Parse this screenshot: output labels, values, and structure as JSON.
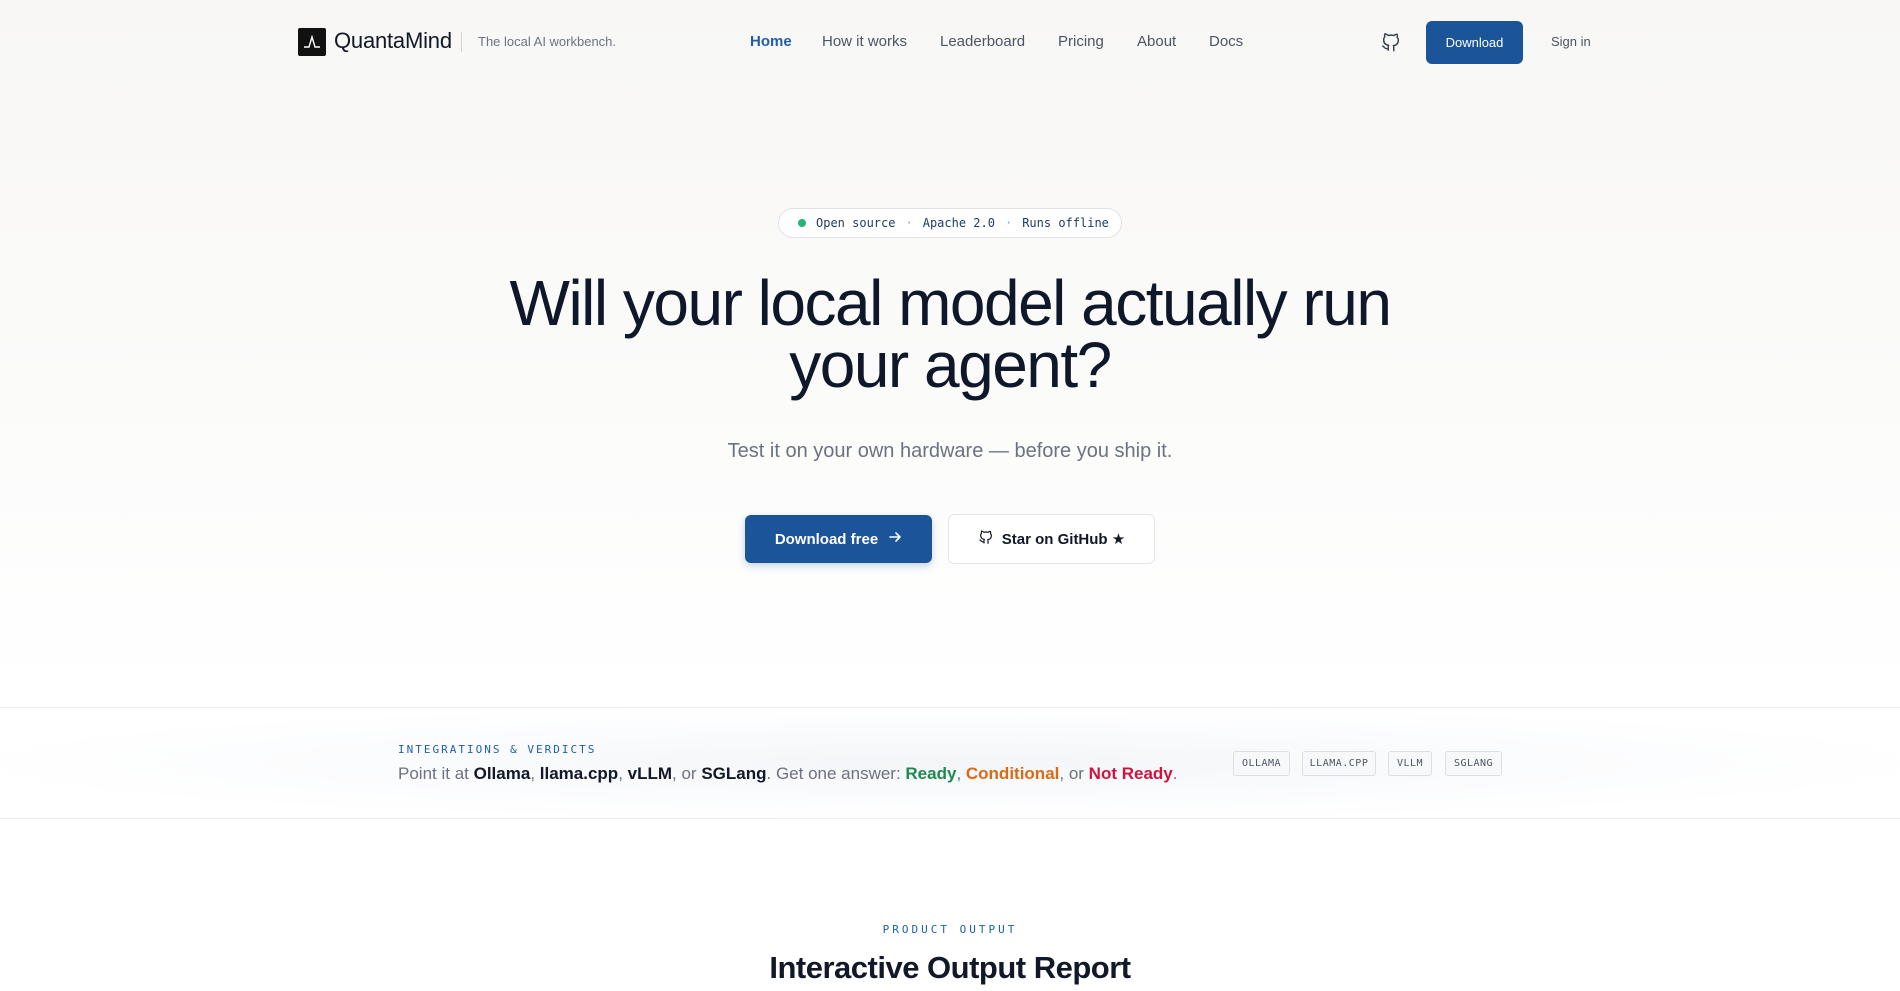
{
  "header": {
    "brand": "QuantaMind",
    "tagline": "The local AI workbench.",
    "nav": [
      "Home",
      "How it works",
      "Leaderboard",
      "Pricing",
      "About",
      "Docs"
    ],
    "active_nav": "Home",
    "download_label": "Download",
    "signin_label": "Sign in",
    "github_icon": "github-icon"
  },
  "hero": {
    "pill": {
      "status_color": "#22b573",
      "items": [
        "Open source",
        "Apache 2.0",
        "Runs offline"
      ]
    },
    "headline_line1": "Will your local model actually run",
    "headline_line2": "your agent?",
    "subhead": "Test it on your own hardware — before you ship it.",
    "primary_cta": "Download free",
    "secondary_cta": "Star on GitHub ★"
  },
  "integrations": {
    "label": "INTEGRATIONS & VERDICTS",
    "text_prefix": "Point it at ",
    "engines": [
      "Ollama",
      "llama.cpp",
      "vLLM",
      "SGLang"
    ],
    "text_mid": ". Get one answer: ",
    "verdicts": [
      {
        "label": "Ready",
        "color": "#1e8a4f"
      },
      {
        "label": "Conditional",
        "color": "#d96a16"
      },
      {
        "label": "Not Ready",
        "color": "#d0133f"
      }
    ],
    "tags": [
      "OLLAMA",
      "LLAMA.CPP",
      "VLLM",
      "SGLANG"
    ]
  },
  "product_output": {
    "label": "PRODUCT OUTPUT",
    "title": "Interactive Output Report"
  },
  "colors": {
    "accent": "#1b5499",
    "accent_text": "#1f5fa8"
  }
}
